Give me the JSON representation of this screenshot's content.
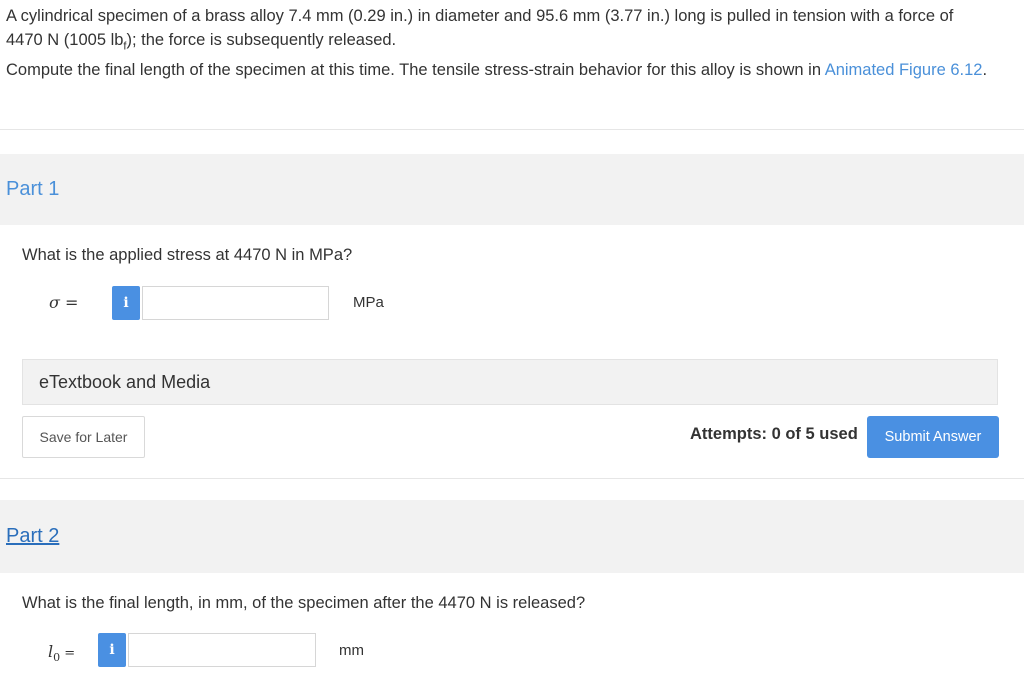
{
  "problem": {
    "line1": "A cylindrical specimen of a brass alloy 7.4 mm (0.29 in.) in diameter and 95.6 mm (3.77 in.) long is pulled in tension with a force of",
    "line2_pre": "4470 N (1005 lb",
    "line2_sub": "f",
    "line2_post": "); the force is subsequently released.",
    "line3": "Compute the final length of the specimen at this time. The tensile stress-strain behavior for this alloy is shown in ",
    "link_text": "Animated Figure 6.12",
    "line3_end": "."
  },
  "part1": {
    "title": "Part 1",
    "question": "What is the applied stress at 4470 N in MPa?",
    "variable": "σ =",
    "input_value": "",
    "unit": "MPa",
    "info_icon": "i",
    "etextbook_label": "eTextbook and Media",
    "save_label": "Save for Later",
    "attempts": "Attempts: 0 of 5 used",
    "submit_label": "Submit Answer"
  },
  "part2": {
    "title": "Part 2",
    "question": "What is the final length, in mm, of the specimen after the 4470 N is released?",
    "variable_base": "l",
    "variable_sub": "0",
    "variable_eq": " =",
    "input_value": "",
    "unit": "mm",
    "info_icon": "i"
  },
  "colors": {
    "accent": "#4a90e2",
    "link": "#4a90d9",
    "band": "#f2f2f2"
  }
}
